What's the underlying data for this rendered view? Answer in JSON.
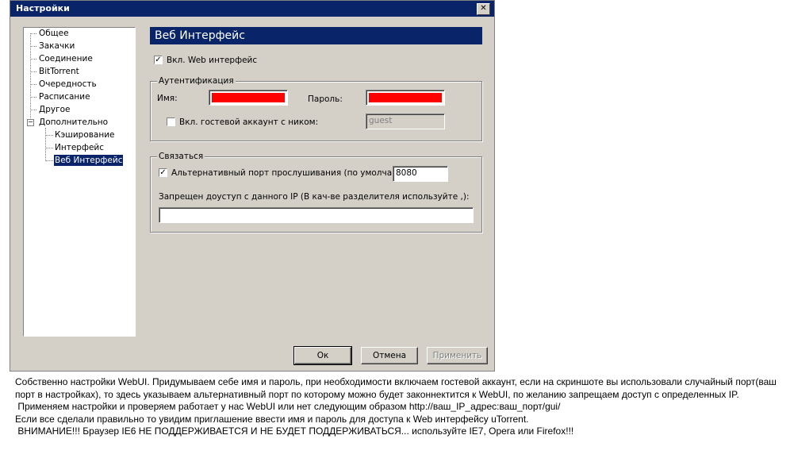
{
  "window": {
    "title": "Настройки",
    "close_glyph": "✕"
  },
  "tree": {
    "items": [
      {
        "label": "Общее"
      },
      {
        "label": "Закачки"
      },
      {
        "label": "Соединение"
      },
      {
        "label": "BitTorrent"
      },
      {
        "label": "Очередность"
      },
      {
        "label": "Расписание"
      },
      {
        "label": "Другое"
      },
      {
        "label": "Дополнительно",
        "expanded": true
      },
      {
        "label": "Кэширование"
      },
      {
        "label": "Интерфейс"
      },
      {
        "label": "Веб Интерфейс",
        "selected": true
      }
    ],
    "expander_glyph": "−"
  },
  "panel": {
    "header": "Веб Интерфейс",
    "enable_web_label": "Вкл. Web интерфейс",
    "enable_web_checked": true,
    "auth": {
      "title": "Аутентификация",
      "name_label": "Имя:",
      "password_label": "Пароль:",
      "guest_label": "Вкл. гостевой аккаунт с ником:",
      "guest_checked": false,
      "guest_value": "guest"
    },
    "connect": {
      "title": "Связаться",
      "alt_port_label": "Альтернативный порт прослушивания (по умолчанию",
      "alt_port_checked": true,
      "alt_port_value": "8080",
      "ip_label": "Запрещен доуступ с данного IP (В кач-ве разделителя используйте ,):",
      "ip_value": ""
    },
    "check_glyph": "✓"
  },
  "buttons": {
    "ok": "Ок",
    "cancel": "Отмена",
    "apply": "Применить"
  },
  "body_text": [
    "Собственно настройки WebUI. Придумываем себе имя и пароль, при необходимости включаем гостевой аккаунт, если на скриншоте вы использовали случайный порт(ваш порт в настройках), то здесь указываем альтернативный порт по которому можно будет законнектится к WebUI, по желанию запрещаем доступ с определенных IP.",
    " Применяем настройки и проверяем работает у нас WebUI или нет следующим образом http://ваш_IP_адрес:ваш_порт/gui/",
    "Если все сделали правильно то увидим приглашение ввести имя и пароль для доступа к Web интерфейсу uTorrent.",
    " ВНИМАНИЕ!!! Браузер IE6 НЕ ПОДДЕРЖИВАЕТСЯ И НЕ БУДЕТ ПОДДЕРЖИВАТЬСЯ... используйте IE7, Opera или Firefox!!!"
  ],
  "colors": {
    "title_bar": "#0a246a",
    "dialog_bg": "#d4d0c8",
    "masked_field": "#ff0000"
  }
}
